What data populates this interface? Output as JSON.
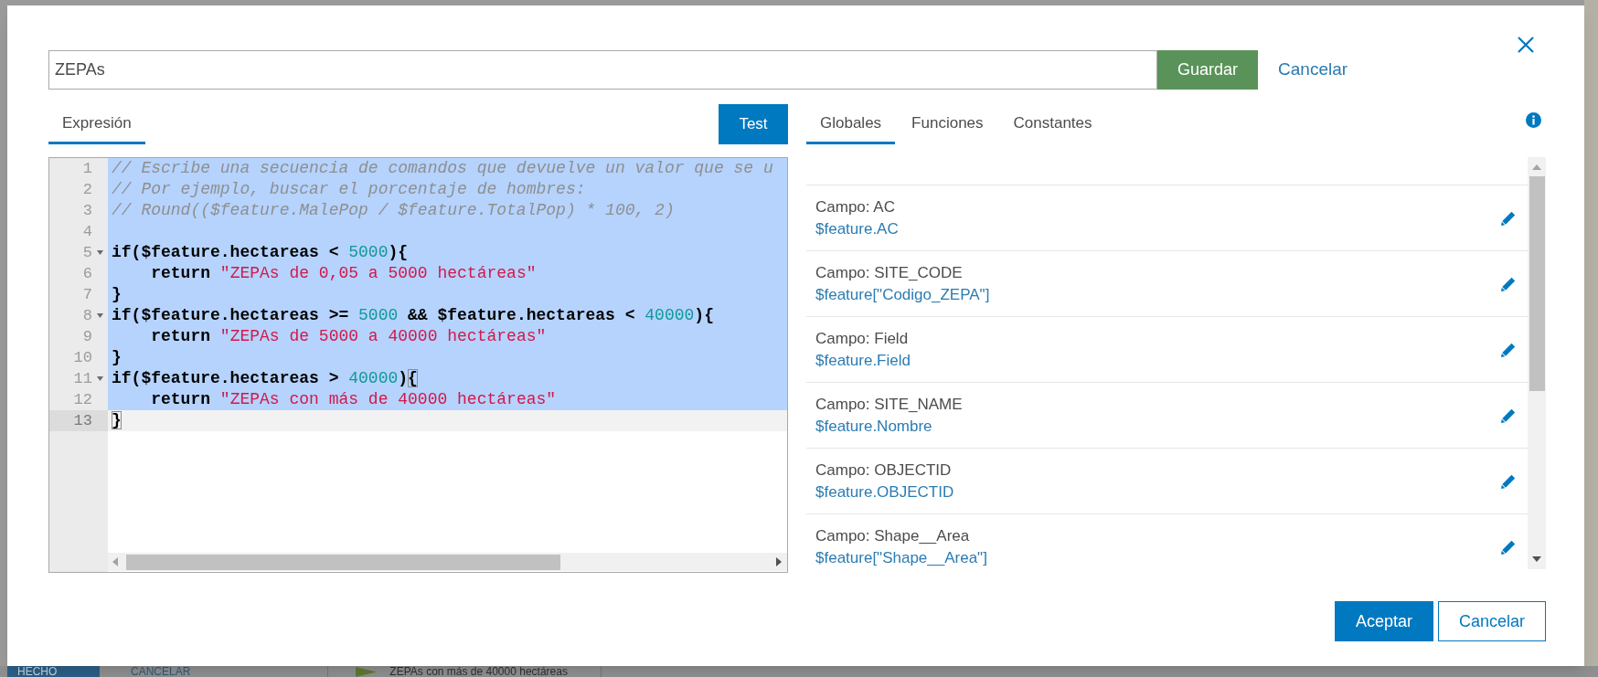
{
  "dialog": {
    "name_field": {
      "value": "ZEPAs"
    },
    "save_button": {
      "label": "Guardar"
    },
    "cancel_link": {
      "label": "Cancelar"
    },
    "editor_tabs": [
      {
        "label": "Expresión",
        "selected": true
      }
    ],
    "test_button": {
      "label": "Test"
    },
    "editor": {
      "lines": [
        {
          "number": "1",
          "fold": false,
          "selected": true,
          "active": false,
          "tokens": [
            {
              "kind": "comment",
              "text": "// Escribe una secuencia de comandos que devuelve un valor que se u"
            }
          ]
        },
        {
          "number": "2",
          "fold": false,
          "selected": true,
          "active": false,
          "tokens": [
            {
              "kind": "comment",
              "text": "// Por ejemplo, buscar el porcentaje de hombres:"
            }
          ]
        },
        {
          "number": "3",
          "fold": false,
          "selected": true,
          "active": false,
          "tokens": [
            {
              "kind": "comment",
              "text": "// Round(($feature.MalePop / $feature.TotalPop) * 100, 2)"
            }
          ]
        },
        {
          "number": "4",
          "fold": false,
          "selected": true,
          "active": false
        },
        {
          "number": "5",
          "fold": true,
          "selected": true,
          "active": false,
          "tokens": [
            {
              "kind": "code",
              "text": "if($feature.hectareas < "
            },
            {
              "kind": "number",
              "text": "5000"
            },
            {
              "kind": "code",
              "text": "){"
            }
          ]
        },
        {
          "number": "6",
          "fold": false,
          "selected": true,
          "active": false,
          "tokens": [
            {
              "kind": "code",
              "text": "    return "
            },
            {
              "kind": "string",
              "text": "\"ZEPAs de 0,05 a 5000 hectáreas\""
            }
          ]
        },
        {
          "number": "7",
          "fold": false,
          "selected": true,
          "active": false,
          "tokens": [
            {
              "kind": "code",
              "text": "}"
            }
          ]
        },
        {
          "number": "8",
          "fold": true,
          "selected": true,
          "active": false,
          "tokens": [
            {
              "kind": "code",
              "text": "if($feature.hectareas >= "
            },
            {
              "kind": "number",
              "text": "5000"
            },
            {
              "kind": "code",
              "text": " && $feature.hectareas < "
            },
            {
              "kind": "number",
              "text": "40000"
            },
            {
              "kind": "code",
              "text": "){"
            }
          ]
        },
        {
          "number": "9",
          "fold": false,
          "selected": true,
          "active": false,
          "tokens": [
            {
              "kind": "code",
              "text": "    return "
            },
            {
              "kind": "string",
              "text": "\"ZEPAs de 5000 a 40000 hectáreas\""
            }
          ]
        },
        {
          "number": "10",
          "fold": false,
          "selected": true,
          "active": false,
          "tokens": [
            {
              "kind": "code",
              "text": "}"
            }
          ]
        },
        {
          "number": "11",
          "fold": true,
          "selected": true,
          "active": false,
          "tokens": [
            {
              "kind": "code",
              "text": "if($feature.hectareas > "
            },
            {
              "kind": "number",
              "text": "40000"
            },
            {
              "kind": "code",
              "text": ")"
            },
            {
              "kind": "bracket",
              "text": "{"
            }
          ]
        },
        {
          "number": "12",
          "fold": false,
          "selected": true,
          "active": false,
          "tokens": [
            {
              "kind": "code",
              "text": "    return "
            },
            {
              "kind": "string",
              "text": "\"ZEPAs con más de 40000 hectáreas\""
            }
          ]
        },
        {
          "number": "13",
          "fold": false,
          "selected": false,
          "active": true,
          "tokens": [
            {
              "kind": "bracket",
              "text": "}"
            }
          ]
        }
      ]
    },
    "side_tabs": [
      {
        "label": "Globales",
        "selected": true
      },
      {
        "label": "Funciones",
        "selected": false
      },
      {
        "label": "Constantes",
        "selected": false
      }
    ],
    "globals": [
      {
        "label": "Campo: AC",
        "value": "$feature.AC"
      },
      {
        "label": "Campo: SITE_CODE",
        "value": "$feature[\"Codigo_ZEPA\"]"
      },
      {
        "label": "Campo: Field",
        "value": "$feature.Field"
      },
      {
        "label": "Campo: SITE_NAME",
        "value": "$feature.Nombre"
      },
      {
        "label": "Campo: OBJECTID",
        "value": "$feature.OBJECTID"
      },
      {
        "label": "Campo: Shape__Area",
        "value": "$feature[\"Shape__Area\"]"
      }
    ],
    "footer_buttons": [
      {
        "label": "Aceptar",
        "kind": "primary"
      },
      {
        "label": "Cancelar",
        "kind": "secondary"
      }
    ]
  },
  "background": {
    "bottom_bar": {
      "buttons": [
        {
          "label": "HECHO",
          "kind": "primary"
        },
        {
          "label": "CANCELAR",
          "kind": "text"
        }
      ],
      "legend_item": {
        "label": "ZEPAs con más de 40000 hectáreas"
      }
    }
  }
}
